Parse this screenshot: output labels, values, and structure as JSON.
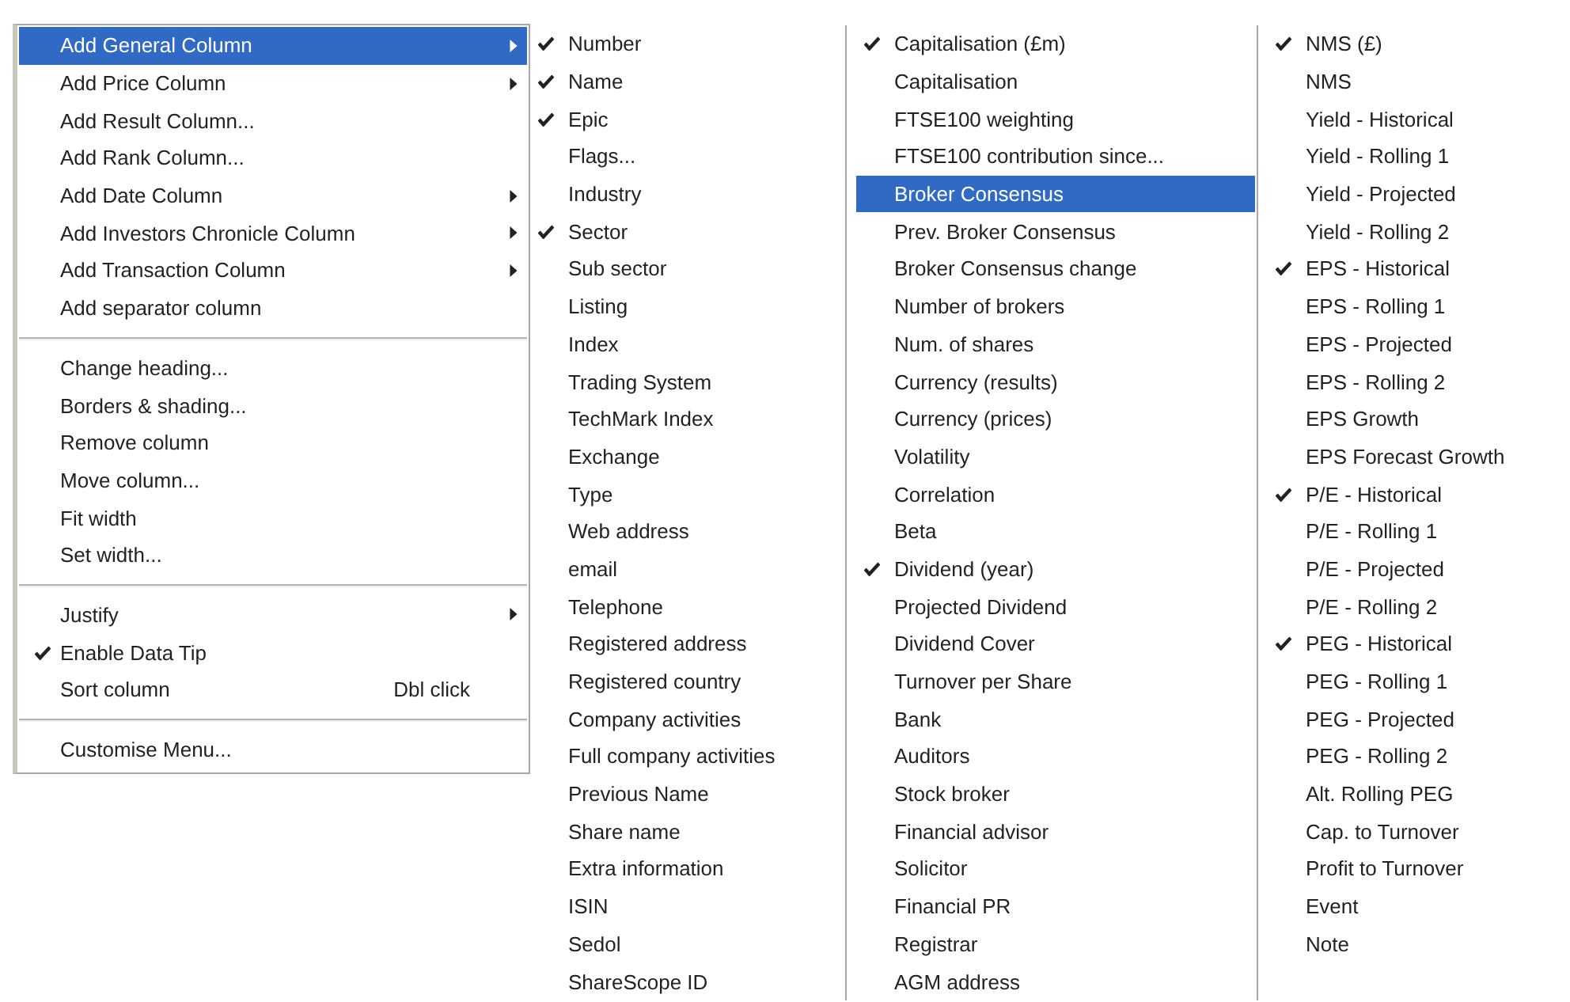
{
  "main_menu": {
    "sections": [
      {
        "items": [
          {
            "label": "Add General Column",
            "has_submenu": true,
            "checked": false,
            "selected": true
          },
          {
            "label": "Add Price Column",
            "has_submenu": true,
            "checked": false,
            "selected": false
          },
          {
            "label": "Add Result Column...",
            "has_submenu": false,
            "checked": false,
            "selected": false
          },
          {
            "label": "Add Rank Column...",
            "has_submenu": false,
            "checked": false,
            "selected": false
          },
          {
            "label": "Add Date Column",
            "has_submenu": true,
            "checked": false,
            "selected": false
          },
          {
            "label": "Add Investors Chronicle Column",
            "has_submenu": true,
            "checked": false,
            "selected": false
          },
          {
            "label": "Add Transaction Column",
            "has_submenu": true,
            "checked": false,
            "selected": false
          },
          {
            "label": "Add separator column",
            "has_submenu": false,
            "checked": false,
            "selected": false
          }
        ]
      },
      {
        "items": [
          {
            "label": "Change heading...",
            "has_submenu": false,
            "checked": false,
            "selected": false
          },
          {
            "label": "Borders & shading...",
            "has_submenu": false,
            "checked": false,
            "selected": false
          },
          {
            "label": "Remove column",
            "has_submenu": false,
            "checked": false,
            "selected": false
          },
          {
            "label": "Move column...",
            "has_submenu": false,
            "checked": false,
            "selected": false
          },
          {
            "label": "Fit width",
            "has_submenu": false,
            "checked": false,
            "selected": false
          },
          {
            "label": "Set width...",
            "has_submenu": false,
            "checked": false,
            "selected": false
          }
        ]
      },
      {
        "items": [
          {
            "label": "Justify",
            "has_submenu": true,
            "checked": false,
            "selected": false
          },
          {
            "label": "Enable Data Tip",
            "has_submenu": false,
            "checked": true,
            "selected": false
          },
          {
            "label": "Sort column",
            "shortcut": "Dbl click",
            "has_submenu": false,
            "checked": false,
            "selected": false
          }
        ]
      },
      {
        "items": [
          {
            "label": "Customise Menu...",
            "has_submenu": false,
            "checked": false,
            "selected": false
          }
        ]
      }
    ]
  },
  "submenu": {
    "columns": [
      {
        "items": [
          {
            "label": "Number",
            "checked": true,
            "selected": false
          },
          {
            "label": "Name",
            "checked": true,
            "selected": false
          },
          {
            "label": "Epic",
            "checked": true,
            "selected": false
          },
          {
            "label": "Flags...",
            "checked": false,
            "selected": false
          },
          {
            "label": "Industry",
            "checked": false,
            "selected": false
          },
          {
            "label": "Sector",
            "checked": true,
            "selected": false
          },
          {
            "label": "Sub sector",
            "checked": false,
            "selected": false
          },
          {
            "label": "Listing",
            "checked": false,
            "selected": false
          },
          {
            "label": "Index",
            "checked": false,
            "selected": false
          },
          {
            "label": "Trading System",
            "checked": false,
            "selected": false
          },
          {
            "label": "TechMark Index",
            "checked": false,
            "selected": false
          },
          {
            "label": "Exchange",
            "checked": false,
            "selected": false
          },
          {
            "label": "Type",
            "checked": false,
            "selected": false
          },
          {
            "label": "Web address",
            "checked": false,
            "selected": false
          },
          {
            "label": "email",
            "checked": false,
            "selected": false
          },
          {
            "label": "Telephone",
            "checked": false,
            "selected": false
          },
          {
            "label": "Registered address",
            "checked": false,
            "selected": false
          },
          {
            "label": "Registered country",
            "checked": false,
            "selected": false
          },
          {
            "label": "Company activities",
            "checked": false,
            "selected": false
          },
          {
            "label": "Full company activities",
            "checked": false,
            "selected": false
          },
          {
            "label": "Previous Name",
            "checked": false,
            "selected": false
          },
          {
            "label": "Share name",
            "checked": false,
            "selected": false
          },
          {
            "label": "Extra information",
            "checked": false,
            "selected": false
          },
          {
            "label": "ISIN",
            "checked": false,
            "selected": false
          },
          {
            "label": "Sedol",
            "checked": false,
            "selected": false
          },
          {
            "label": "ShareScope ID",
            "checked": false,
            "selected": false
          }
        ]
      },
      {
        "items": [
          {
            "label": "Capitalisation (£m)",
            "checked": true,
            "selected": false
          },
          {
            "label": "Capitalisation",
            "checked": false,
            "selected": false
          },
          {
            "label": "FTSE100 weighting",
            "checked": false,
            "selected": false
          },
          {
            "label": "FTSE100 contribution since...",
            "checked": false,
            "selected": false
          },
          {
            "label": "Broker Consensus",
            "checked": false,
            "selected": true
          },
          {
            "label": "Prev. Broker Consensus",
            "checked": false,
            "selected": false
          },
          {
            "label": "Broker Consensus change",
            "checked": false,
            "selected": false
          },
          {
            "label": "Number of brokers",
            "checked": false,
            "selected": false
          },
          {
            "label": "Num. of shares",
            "checked": false,
            "selected": false
          },
          {
            "label": "Currency (results)",
            "checked": false,
            "selected": false
          },
          {
            "label": "Currency (prices)",
            "checked": false,
            "selected": false
          },
          {
            "label": "Volatility",
            "checked": false,
            "selected": false
          },
          {
            "label": "Correlation",
            "checked": false,
            "selected": false
          },
          {
            "label": "Beta",
            "checked": false,
            "selected": false
          },
          {
            "label": "Dividend (year)",
            "checked": true,
            "selected": false
          },
          {
            "label": "Projected Dividend",
            "checked": false,
            "selected": false
          },
          {
            "label": "Dividend Cover",
            "checked": false,
            "selected": false
          },
          {
            "label": "Turnover per Share",
            "checked": false,
            "selected": false
          },
          {
            "label": "Bank",
            "checked": false,
            "selected": false
          },
          {
            "label": "Auditors",
            "checked": false,
            "selected": false
          },
          {
            "label": "Stock broker",
            "checked": false,
            "selected": false
          },
          {
            "label": "Financial advisor",
            "checked": false,
            "selected": false
          },
          {
            "label": "Solicitor",
            "checked": false,
            "selected": false
          },
          {
            "label": "Financial PR",
            "checked": false,
            "selected": false
          },
          {
            "label": "Registrar",
            "checked": false,
            "selected": false
          },
          {
            "label": "AGM address",
            "checked": false,
            "selected": false
          }
        ]
      },
      {
        "items": [
          {
            "label": "NMS (£)",
            "checked": true,
            "selected": false
          },
          {
            "label": "NMS",
            "checked": false,
            "selected": false
          },
          {
            "label": "Yield - Historical",
            "checked": false,
            "selected": false
          },
          {
            "label": "Yield - Rolling 1",
            "checked": false,
            "selected": false
          },
          {
            "label": "Yield - Projected",
            "checked": false,
            "selected": false
          },
          {
            "label": "Yield - Rolling 2",
            "checked": false,
            "selected": false
          },
          {
            "label": "EPS - Historical",
            "checked": true,
            "selected": false
          },
          {
            "label": "EPS - Rolling 1",
            "checked": false,
            "selected": false
          },
          {
            "label": "EPS - Projected",
            "checked": false,
            "selected": false
          },
          {
            "label": "EPS - Rolling 2",
            "checked": false,
            "selected": false
          },
          {
            "label": "EPS Growth",
            "checked": false,
            "selected": false
          },
          {
            "label": "EPS Forecast Growth",
            "checked": false,
            "selected": false
          },
          {
            "label": "P/E - Historical",
            "checked": true,
            "selected": false
          },
          {
            "label": "P/E - Rolling 1",
            "checked": false,
            "selected": false
          },
          {
            "label": "P/E - Projected",
            "checked": false,
            "selected": false
          },
          {
            "label": "P/E - Rolling 2",
            "checked": false,
            "selected": false
          },
          {
            "label": "PEG - Historical",
            "checked": true,
            "selected": false
          },
          {
            "label": "PEG - Rolling 1",
            "checked": false,
            "selected": false
          },
          {
            "label": "PEG - Projected",
            "checked": false,
            "selected": false
          },
          {
            "label": "PEG - Rolling 2",
            "checked": false,
            "selected": false
          },
          {
            "label": "Alt. Rolling PEG",
            "checked": false,
            "selected": false
          },
          {
            "label": "Cap. to Turnover",
            "checked": false,
            "selected": false
          },
          {
            "label": "Profit to Turnover",
            "checked": false,
            "selected": false
          },
          {
            "label": "Event",
            "checked": false,
            "selected": false
          },
          {
            "label": "Note",
            "checked": false,
            "selected": false
          }
        ]
      }
    ]
  }
}
